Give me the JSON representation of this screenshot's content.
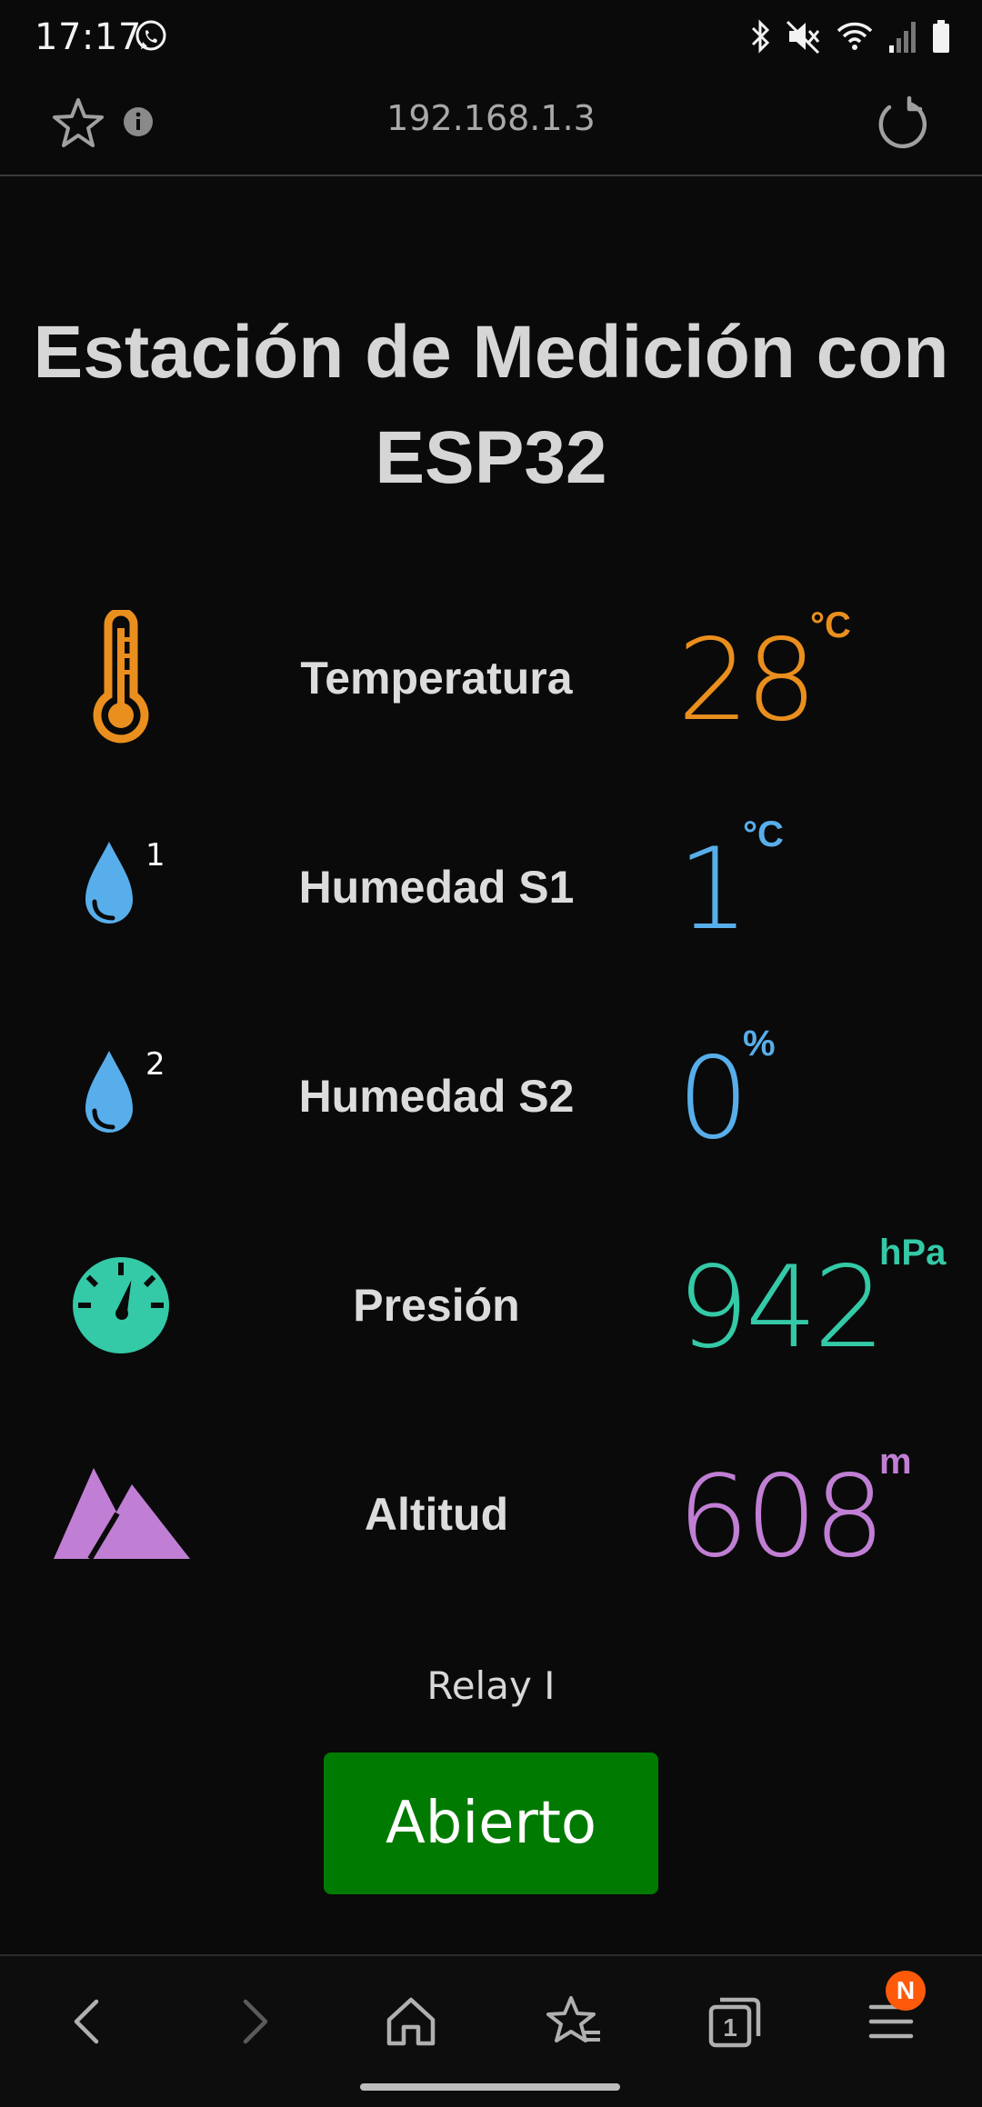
{
  "status_bar": {
    "time": "17:17",
    "icons": [
      "whatsapp-icon",
      "bluetooth-icon",
      "mute-icon",
      "wifi-icon",
      "signal-icon",
      "battery-icon"
    ]
  },
  "browser": {
    "url": "192.168.1.3"
  },
  "page": {
    "title": "Estación de Medición con ESP32",
    "readings": [
      {
        "label": "Temperatura",
        "value": "28",
        "unit": "°C",
        "color": "#ea8f1e",
        "icon": "thermometer-icon"
      },
      {
        "label": "Humedad S1",
        "value": "1",
        "unit": "°C",
        "color": "#58aeea",
        "icon": "water-drop-icon",
        "icon_badge": "1"
      },
      {
        "label": "Humedad S2",
        "value": "0",
        "unit": "%",
        "color": "#58aeea",
        "icon": "water-drop-icon",
        "icon_badge": "2"
      },
      {
        "label": "Presión",
        "value": "942",
        "unit": "hPa",
        "color": "#34c9a7",
        "icon": "gauge-icon"
      },
      {
        "label": "Altitud",
        "value": "608",
        "unit": "m",
        "color": "#c07fd4",
        "icon": "mountain-icon"
      }
    ],
    "relay": {
      "label": "Relay I",
      "button_label": "Abierto",
      "button_color": "#007a00"
    }
  },
  "bottom_nav": {
    "items": [
      "back-icon",
      "forward-icon",
      "home-icon",
      "bookmarks-icon",
      "tabs-icon",
      "menu-icon"
    ],
    "tabs_count": "1",
    "menu_badge": "N"
  }
}
